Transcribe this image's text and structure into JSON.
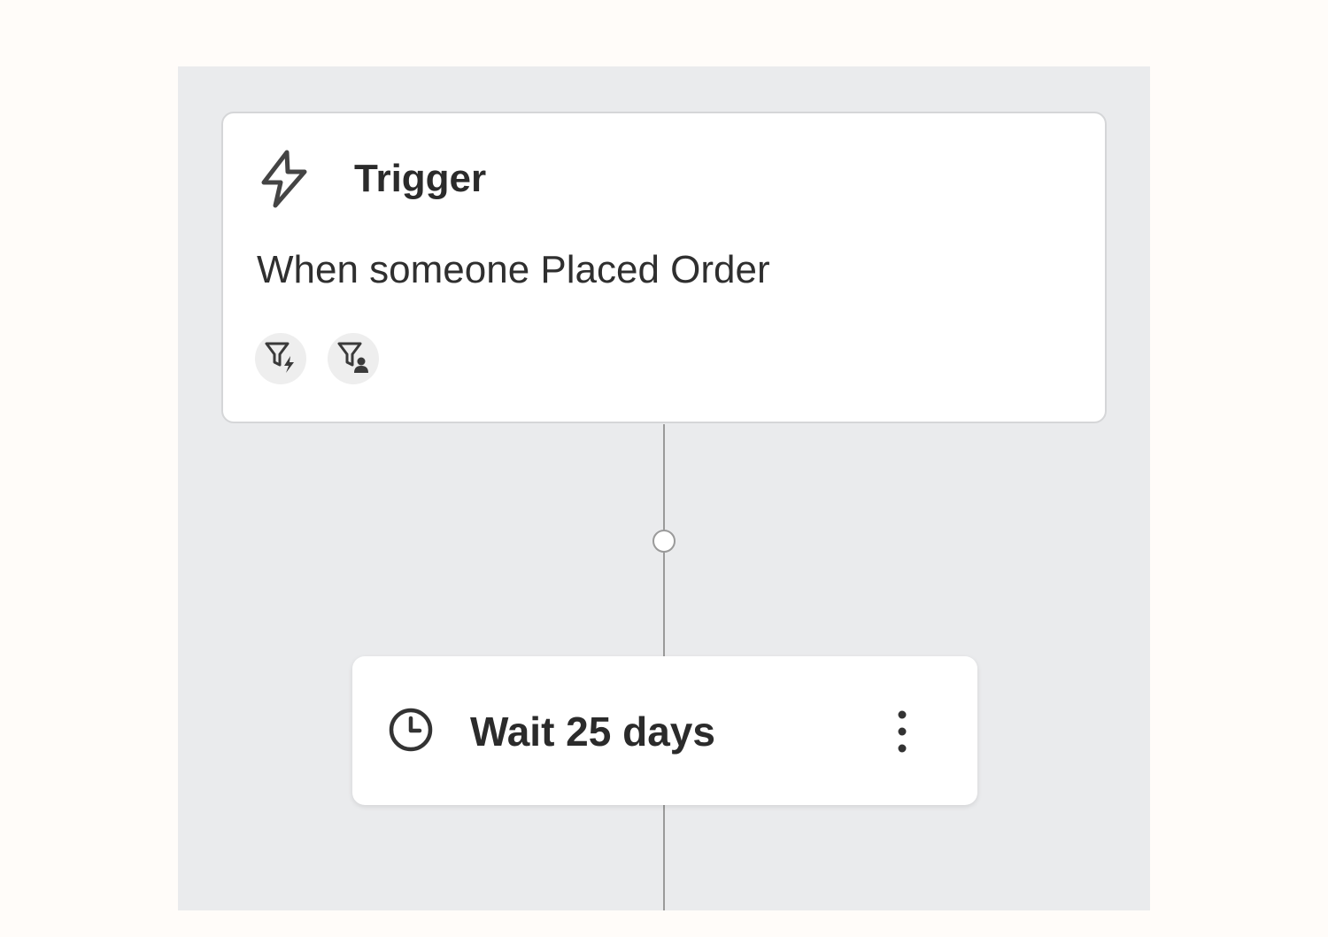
{
  "flow": {
    "trigger": {
      "icon": "lightning-bolt-icon",
      "title": "Trigger",
      "description": "When someone Placed Order",
      "filters": [
        {
          "icon": "trigger-filter-icon"
        },
        {
          "icon": "profile-filter-icon"
        }
      ]
    },
    "connector": {
      "add_node_icon": "add-step-node"
    },
    "wait_step": {
      "icon": "clock-icon",
      "label": "Wait 25 days",
      "menu_icon": "more-vertical-icon"
    }
  }
}
